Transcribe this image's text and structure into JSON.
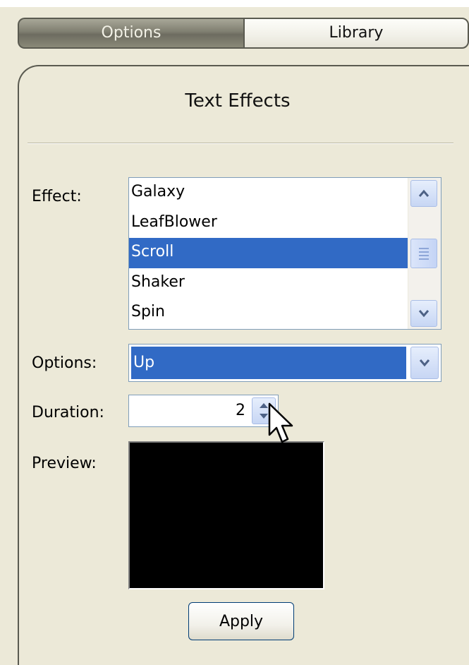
{
  "tabs": [
    {
      "label": "Options",
      "active": true
    },
    {
      "label": "Library",
      "active": false
    }
  ],
  "panel": {
    "title": "Text Effects"
  },
  "effect": {
    "label": "Effect:",
    "items": [
      "Galaxy",
      "LeafBlower",
      "Scroll",
      "Shaker",
      "Spin"
    ],
    "selected": "Scroll"
  },
  "options": {
    "label": "Options:",
    "value": "Up"
  },
  "duration": {
    "label": "Duration:",
    "value": "2"
  },
  "preview": {
    "label": "Preview:"
  },
  "apply": {
    "label": "Apply"
  },
  "colors": {
    "selection": "#316ac5",
    "panel_bg": "#ece9d8",
    "preview_bg": "#000000"
  },
  "icons": [
    "scroll-up-icon",
    "scroll-down-icon",
    "dropdown-chevron-icon",
    "spin-up-icon",
    "spin-down-icon",
    "mouse-pointer-icon"
  ]
}
